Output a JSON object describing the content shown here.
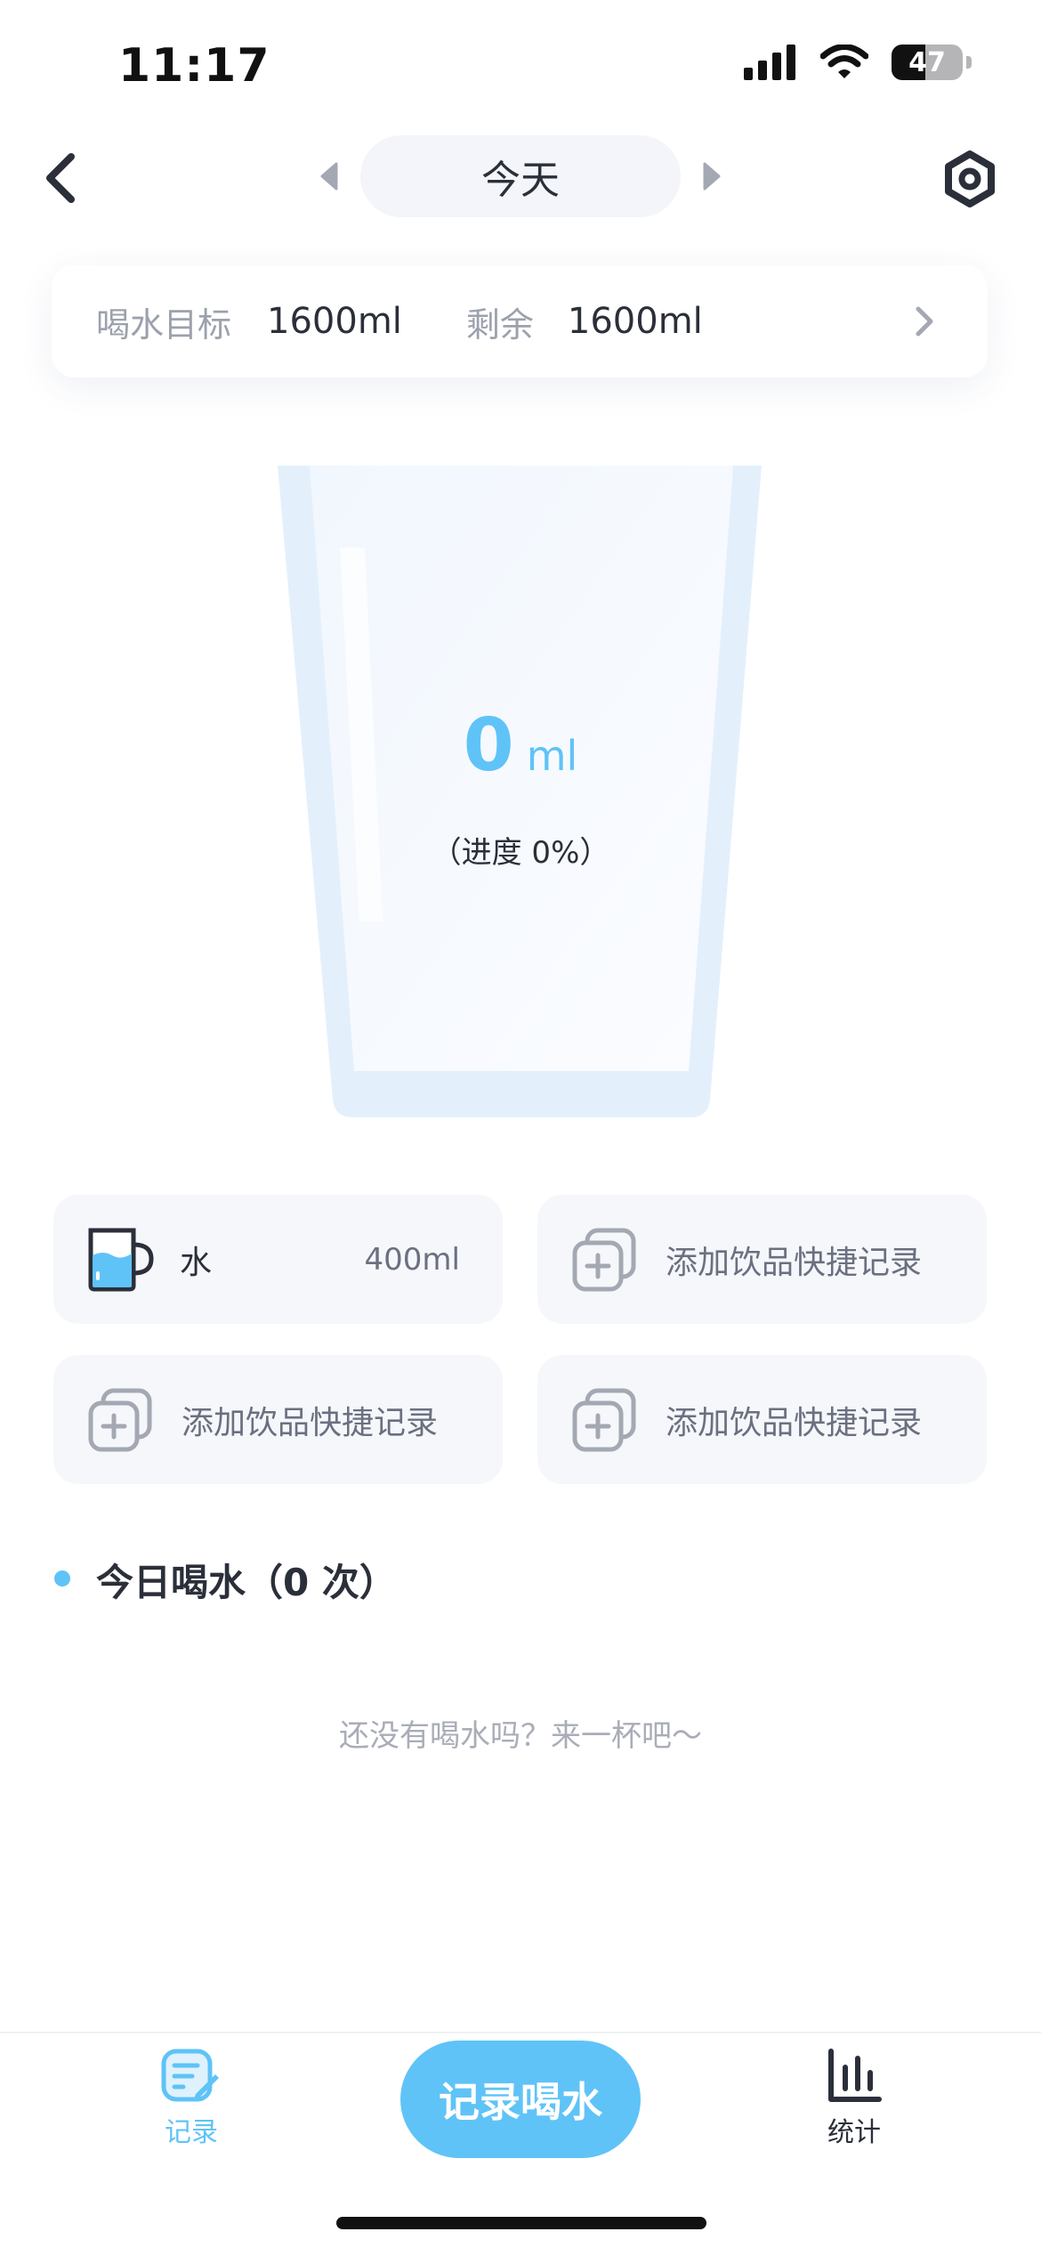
{
  "status_bar": {
    "time": "11:17",
    "battery": "47"
  },
  "header": {
    "date_label": "今天",
    "icons": {
      "back": "chevron-left-icon",
      "settings": "hexagon-gear-icon",
      "prev": "triangle-left-icon",
      "next": "triangle-right-icon"
    }
  },
  "goal": {
    "target_label": "喝水目标",
    "target_value": "1600ml",
    "remaining_label": "剩余",
    "remaining_value": "1600ml"
  },
  "cup": {
    "amount": "0",
    "unit": "ml",
    "progress_text": "（进度 0%）",
    "progress_fraction": 0
  },
  "quick_records": [
    {
      "name": "水",
      "amount": "400ml",
      "icon": "mug-icon"
    },
    {
      "label": "添加饮品快捷记录",
      "icon": "add-stack-icon"
    },
    {
      "label": "添加饮品快捷记录",
      "icon": "add-stack-icon"
    },
    {
      "label": "添加饮品快捷记录",
      "icon": "add-stack-icon"
    }
  ],
  "today": {
    "title": "今日喝水（0 次）",
    "empty_hint": "还没有喝水吗？来一杯吧～"
  },
  "bottom_nav": {
    "record_tab": "记录",
    "record_button": "记录喝水",
    "stats_tab": "统计"
  },
  "colors": {
    "accent": "#5fc3f7",
    "text": "#2b2f3a",
    "muted": "#9ca1ad",
    "card_bg": "#f5f7fb"
  }
}
